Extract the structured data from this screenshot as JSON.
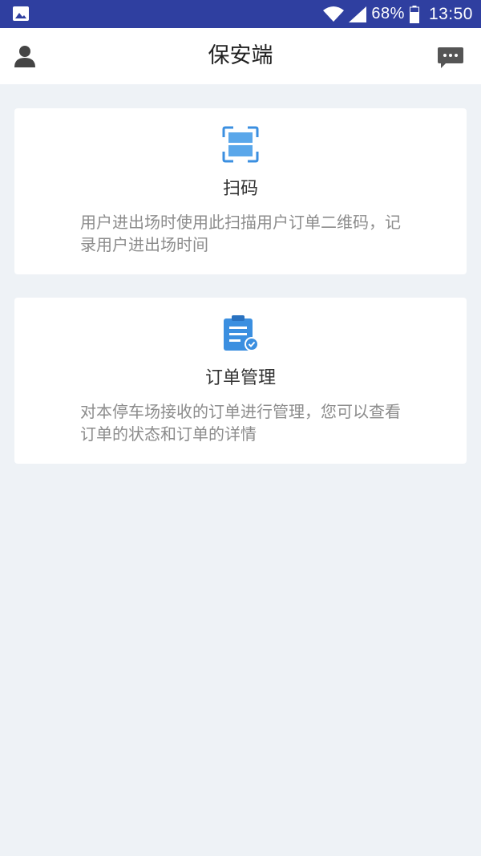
{
  "status_bar": {
    "battery": "68%",
    "time": "13:50"
  },
  "app_bar": {
    "title": "保安端",
    "left_icon": "user-icon",
    "right_icon": "message-icon"
  },
  "cards": [
    {
      "icon": "scan-icon",
      "title": "扫码",
      "description": "用户进出场时使用此扫描用户订单二维码，记录用户进出场时间"
    },
    {
      "icon": "order-clipboard-icon",
      "title": "订单管理",
      "description": "对本停车场接收的订单进行管理，您可以查看订单的状态和订单的详情"
    }
  ],
  "colors": {
    "status_bar": "#2f3fa0",
    "background": "#eef2f6",
    "accent": "#3b8fe0"
  }
}
